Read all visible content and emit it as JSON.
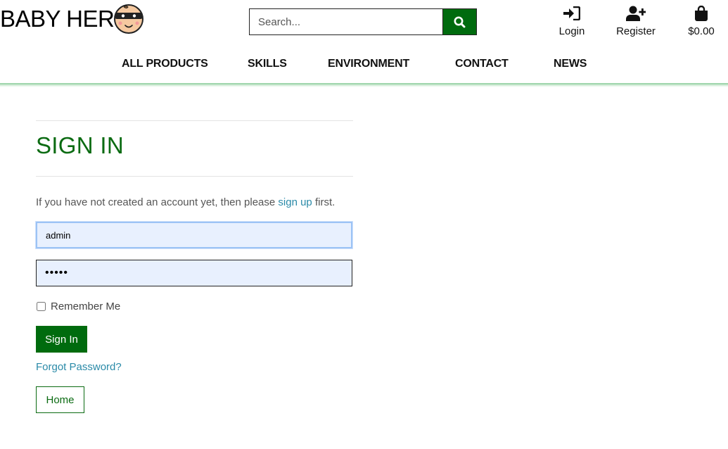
{
  "header": {
    "logo_text": "BABY HER",
    "search": {
      "placeholder": "Search..."
    },
    "account": {
      "login_label": "Login",
      "register_label": "Register",
      "bag_total": "$0.00"
    },
    "nav": [
      {
        "label": "ALL PRODUCTS"
      },
      {
        "label": "SKILLS"
      },
      {
        "label": "ENVIRONMENT"
      },
      {
        "label": "CONTACT"
      },
      {
        "label": "NEWS"
      }
    ]
  },
  "signin": {
    "title": "SIGN IN",
    "note_before": "If you have not created an account yet, then please ",
    "note_link": "sign up",
    "note_after": " first.",
    "username_value": "admin",
    "password_value": "•••••",
    "remember_label": "Remember Me",
    "submit_label": "Sign In",
    "forgot_label": "Forgot Password?",
    "home_label": "Home"
  },
  "colors": {
    "brand_green": "#006b0e",
    "link_blue": "#2a8aa8",
    "autofill_bg": "#e8f0fe"
  },
  "icons": {
    "logo": "baby-ninja-face-icon",
    "search": "search-icon",
    "login": "sign-in-icon",
    "register": "user-plus-icon",
    "bag": "shopping-bag-icon"
  }
}
